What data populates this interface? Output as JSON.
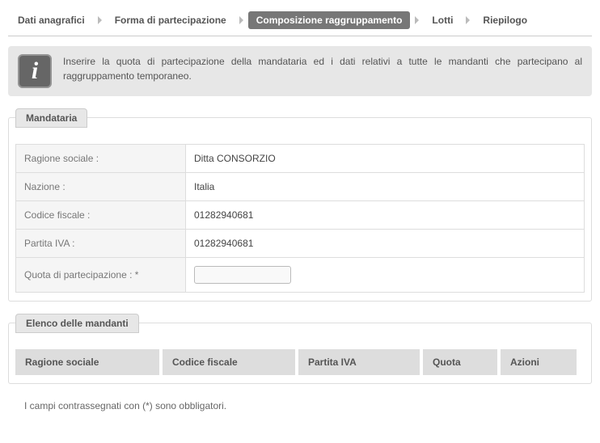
{
  "breadcrumb": {
    "s1": "Dati anagrafici",
    "s2": "Forma di partecipazione",
    "s3": "Composizione raggruppamento",
    "s4": "Lotti",
    "s5": "Riepilogo"
  },
  "info": {
    "text": "Inserire la quota di partecipazione della mandataria ed i dati relativi a tutte le mandanti che partecipano al raggruppamento temporaneo."
  },
  "mandataria": {
    "legend": "Mandataria",
    "rows": {
      "ragione_sociale": {
        "label": "Ragione sociale :",
        "value": "Ditta CONSORZIO"
      },
      "nazione": {
        "label": "Nazione :",
        "value": "Italia"
      },
      "codice_fiscale": {
        "label": "Codice fiscale :",
        "value": "01282940681"
      },
      "partita_iva": {
        "label": "Partita IVA :",
        "value": "01282940681"
      },
      "quota": {
        "label": "Quota di partecipazione : *",
        "value": ""
      }
    }
  },
  "mandanti": {
    "legend": "Elenco delle mandanti",
    "headers": {
      "c1": "Ragione sociale",
      "c2": "Codice fiscale",
      "c3": "Partita IVA",
      "c4": "Quota",
      "c5": "Azioni"
    }
  },
  "footnote": "I campi contrassegnati con (*) sono obbligatori."
}
